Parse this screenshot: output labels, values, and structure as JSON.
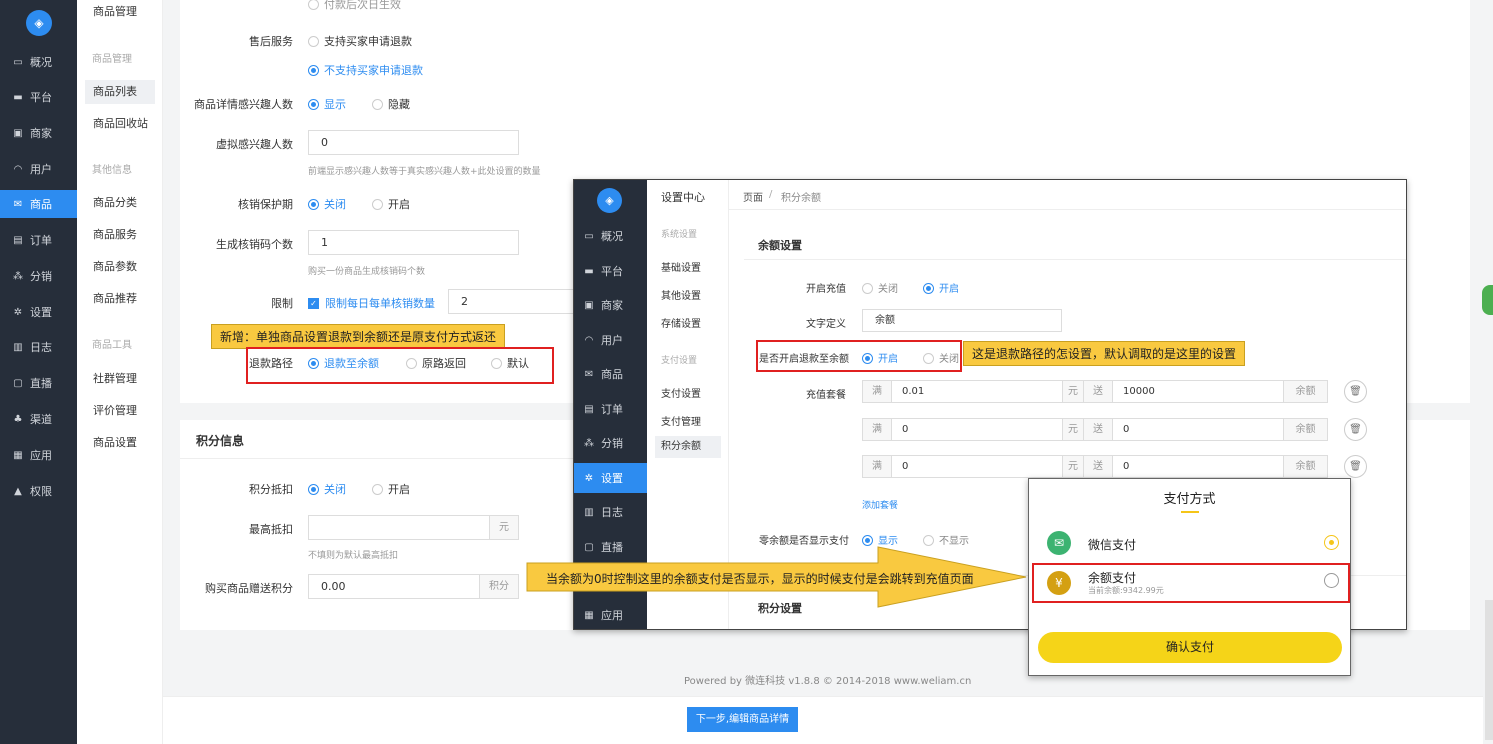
{
  "sidebar": {
    "items": [
      {
        "label": "概况",
        "icon": "monitor-icon"
      },
      {
        "label": "平台",
        "icon": "screen-icon"
      },
      {
        "label": "商家",
        "icon": "store-icon"
      },
      {
        "label": "用户",
        "icon": "user-icon"
      },
      {
        "label": "商品",
        "icon": "goods-icon"
      },
      {
        "label": "订单",
        "icon": "order-icon"
      },
      {
        "label": "分销",
        "icon": "sitemap-icon"
      },
      {
        "label": "设置",
        "icon": "gear-icon"
      },
      {
        "label": "日志",
        "icon": "book-icon"
      },
      {
        "label": "直播",
        "icon": "live-icon"
      },
      {
        "label": "渠道",
        "icon": "channel-icon"
      },
      {
        "label": "应用",
        "icon": "grid-icon"
      },
      {
        "label": "权限",
        "icon": "lock-icon"
      }
    ]
  },
  "subnav": {
    "top": "商品管理",
    "group1": "商品管理",
    "list": "商品列表",
    "recycle": "商品回收站",
    "group2": "其他信息",
    "category": "商品分类",
    "service": "商品服务",
    "params": "商品参数",
    "recommend": "商品推荐",
    "group3": "商品工具",
    "community": "社群管理",
    "review": "评价管理",
    "settings": "商品设置"
  },
  "form": {
    "top_partial": "付款后次日生效",
    "aftersale_label": "售后服务",
    "aftersale_opt1": "支持买家申请退款",
    "aftersale_opt2": "不支持买家申请退款",
    "interest_label": "商品详情感兴趣人数",
    "interest_show": "显示",
    "interest_hide": "隐藏",
    "virtual_label": "虚拟感兴趣人数",
    "virtual_value": "0",
    "virtual_hint": "前端显示感兴趣人数等于真实感兴趣人数+此处设置的数量",
    "verify_label": "核销保护期",
    "verify_off": "关闭",
    "verify_on": "开启",
    "codes_label": "生成核销码个数",
    "codes_value": "1",
    "codes_hint": "购买一份商品生成核销码个数",
    "limit_label": "限制",
    "limit_check": "限制每日每单核销数量",
    "limit_value": "2",
    "refund_label": "退款路径",
    "refund_opt1": "退款至余额",
    "refund_opt2": "原路返回",
    "refund_opt3": "默认"
  },
  "points": {
    "title": "积分信息",
    "deduct_label": "积分抵扣",
    "deduct_off": "关闭",
    "deduct_on": "开启",
    "max_label": "最高抵扣",
    "max_unit": "元",
    "max_hint": "不填则为默认最高抵扣",
    "gift_label": "购买商品赠送积分",
    "gift_value": "0.00",
    "gift_unit": "积分"
  },
  "footer": {
    "powered": "Powered by 微连科技 v1.8.8 © 2014-2018 www.weliam.cn",
    "next_button": "下一步,编辑商品详情"
  },
  "notes": {
    "note1": "新增：单独商品设置退款到余额还是原支付方式返还",
    "note2": "这是退款路径的怎设置，默认调取的是这里的设置",
    "note3": "当余额为0时控制这里的余额支付是否显示，显示的时候支付是会跳转到充值页面"
  },
  "shot2": {
    "nav": [
      {
        "label": "概况",
        "icon": "monitor-icon"
      },
      {
        "label": "平台",
        "icon": "screen-icon"
      },
      {
        "label": "商家",
        "icon": "store-icon"
      },
      {
        "label": "用户",
        "icon": "user-icon"
      },
      {
        "label": "商品",
        "icon": "goods-icon"
      },
      {
        "label": "订单",
        "icon": "order-icon"
      },
      {
        "label": "分销",
        "icon": "sitemap-icon"
      },
      {
        "label": "设置",
        "icon": "gear-icon"
      },
      {
        "label": "日志",
        "icon": "book-icon"
      },
      {
        "label": "直播",
        "icon": "live-icon"
      },
      {
        "label": "应用",
        "icon": "grid-icon"
      }
    ],
    "sub_title": "设置中心",
    "sub_group1": "系统设置",
    "sub_basic": "基础设置",
    "sub_other": "其他设置",
    "sub_storage": "存储设置",
    "sub_group2": "支付设置",
    "sub_pay": "支付设置",
    "sub_paymgr": "支付管理",
    "sub_points": "积分余额",
    "breadcrumb_home": "页面",
    "breadcrumb_sep": "/",
    "breadcrumb_current": "积分余额",
    "section": "余额设置",
    "recharge_label": "开启充值",
    "recharge_off": "关闭",
    "recharge_on": "开启",
    "text_label": "文字定义",
    "text_value": "余额",
    "refund_label": "是否开启退款至余额",
    "refund_on": "开启",
    "refund_off": "关闭",
    "package_label": "充值套餐",
    "packages": [
      {
        "full": "满",
        "amount": "0.01",
        "yuan": "元",
        "give": "送",
        "bonus": "10000",
        "unit": "余额"
      },
      {
        "full": "满",
        "amount": "0",
        "yuan": "元",
        "give": "送",
        "bonus": "0",
        "unit": "余额"
      },
      {
        "full": "满",
        "amount": "0",
        "yuan": "元",
        "give": "送",
        "bonus": "0",
        "unit": "余额"
      }
    ],
    "add_package": "添加套餐",
    "zero_label": "零余额是否显示支付",
    "zero_show": "显示",
    "zero_hide": "不显示",
    "points_section": "积分设置"
  },
  "pay": {
    "title": "支付方式",
    "wechat": "微信支付",
    "balance": "余额支付",
    "balance_sub": "当前余额:9342.99元",
    "confirm": "确认支付"
  }
}
